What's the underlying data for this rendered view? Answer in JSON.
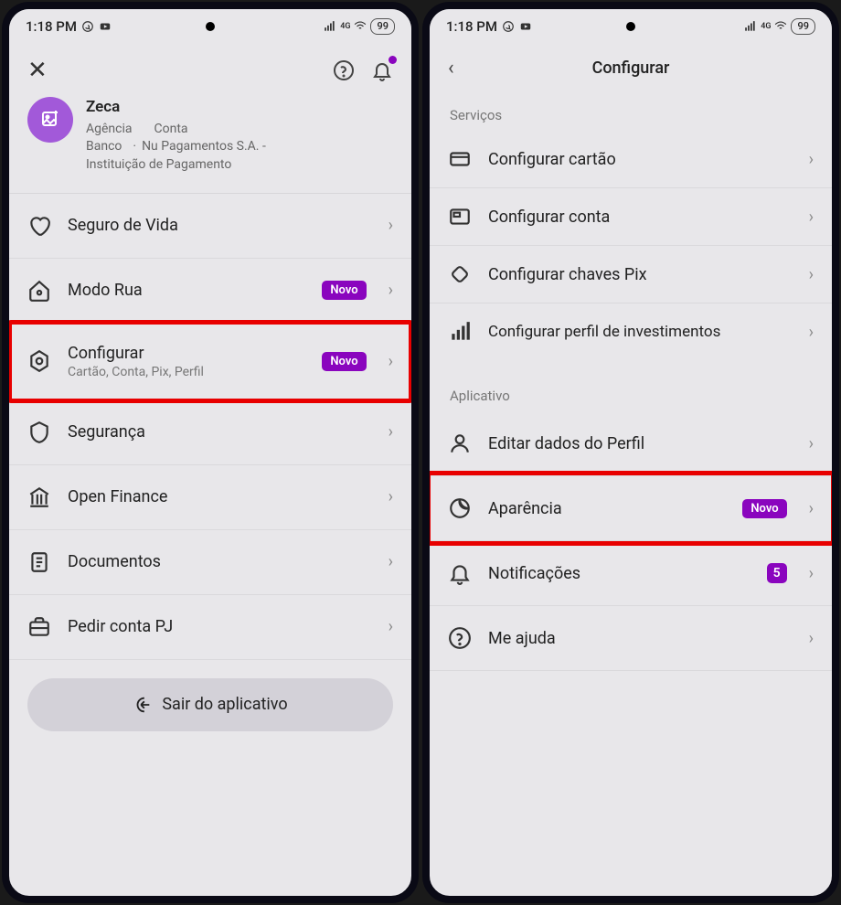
{
  "status": {
    "time": "1:18 PM",
    "battery": "99"
  },
  "left_screen": {
    "profile": {
      "name": "Zeca",
      "agency_label": "Agência",
      "account_label": "Conta",
      "bank_label": "Banco",
      "bank_name": "Nu Pagamentos S.A. -",
      "institution": "Instituição de Pagamento"
    },
    "items": [
      {
        "label": "Seguro de Vida"
      },
      {
        "label": "Modo Rua",
        "badge": "Novo"
      },
      {
        "label": "Configurar",
        "sub": "Cartão, Conta, Pix, Perfil",
        "badge": "Novo",
        "highlight": true
      },
      {
        "label": "Segurança"
      },
      {
        "label": "Open Finance"
      },
      {
        "label": "Documentos"
      },
      {
        "label": "Pedir conta PJ"
      }
    ],
    "logout": "Sair do aplicativo"
  },
  "right_screen": {
    "title": "Configurar",
    "section_services": "Serviços",
    "services": [
      {
        "label": "Configurar cartão"
      },
      {
        "label": "Configurar conta"
      },
      {
        "label": "Configurar chaves Pix"
      },
      {
        "label": "Configurar perfil de investimentos"
      }
    ],
    "section_app": "Aplicativo",
    "app_items": [
      {
        "label": "Editar dados do Perfil"
      },
      {
        "label": "Aparência",
        "badge": "Novo",
        "highlight": true
      },
      {
        "label": "Notificações",
        "count": "5"
      },
      {
        "label": "Me ajuda"
      }
    ]
  }
}
